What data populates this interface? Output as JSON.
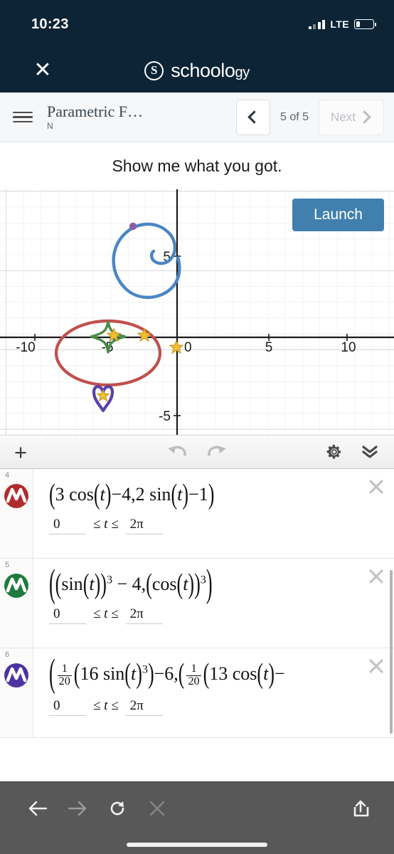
{
  "status_bar": {
    "time": "10:23",
    "network_label": "LTE",
    "signal_icon": "signal-bars-icon",
    "battery_icon": "battery-low-icon",
    "battery_level_pct": 22
  },
  "app_header": {
    "close_icon": "close-icon",
    "brand_mark": "S",
    "brand_name": "schoolo",
    "brand_name_tail": "gy"
  },
  "nav_bar": {
    "menu_icon": "hamburger-menu-icon",
    "title": "Parametric F…",
    "subtitle": "N",
    "prev_icon": "chevron-left-icon",
    "counter": "5 of 5",
    "next_label": "Next",
    "next_icon": "chevron-right-icon"
  },
  "prompt": {
    "text": "Show me what you got."
  },
  "graph": {
    "launch_label": "Launch",
    "accent_blue": "#4180ae",
    "x_ticks": [
      "-10",
      "-5",
      "0",
      "5",
      "10"
    ],
    "y_ticks": [
      "5",
      "-5"
    ],
    "x_range": [
      -12.5,
      12.7
    ],
    "y_range": [
      -6.6,
      8.8
    ],
    "curves": [
      {
        "name": "spiral",
        "color": "#4a86c5"
      },
      {
        "name": "ellipse",
        "color": "#c0504d"
      },
      {
        "name": "astroid",
        "color": "#4a8a4a"
      },
      {
        "name": "heart",
        "color": "#5b3fa8"
      }
    ],
    "point_color": "#8b5fa6",
    "star_color": "#f2c032"
  },
  "action_bar": {
    "add_icon": "plus-icon",
    "undo_icon": "undo-icon",
    "redo_icon": "redo-icon",
    "settings_icon": "gear-icon",
    "collapse_icon": "double-chevron-down-icon"
  },
  "expressions": [
    {
      "index": "4",
      "color": "#b02b2c",
      "icon": "parametric-curve-icon",
      "delete_icon": "close-icon",
      "formula_html": "<span class=\"paren\">(</span>3 <span class=\"fn\">cos</span><span class=\"paren\">(</span><span class=\"var\">t</span><span class=\"paren\">)</span>&#8722;4,2 <span class=\"fn\">sin</span><span class=\"paren\">(</span><span class=\"var\">t</span><span class=\"paren\">)</span>&#8722;1<span class=\"paren\">)</span>",
      "formula_text": "(3 cos(t)-4, 2 sin(t)-1)",
      "domain_min": "0",
      "domain_mid": "≤ t ≤",
      "domain_max": "2π"
    },
    {
      "index": "5",
      "color": "#1f7a3d",
      "icon": "parametric-curve-icon",
      "delete_icon": "close-icon",
      "formula_html": "<span class=\"bigparen\">(</span><span class=\"paren\">(</span><span class=\"fn\">sin</span><span class=\"paren\">(</span><span class=\"var\">t</span><span class=\"paren\">)</span><span class=\"paren\">)</span><sup class=\"exp\">3</sup> &#8722; 4,<span class=\"paren\">(</span><span class=\"fn\">cos</span><span class=\"paren\">(</span><span class=\"var\">t</span><span class=\"paren\">)</span><span class=\"paren\">)</span><sup class=\"exp\">3</sup><span class=\"bigparen\">)</span>",
      "formula_text": "((sin(t))^3 - 4, (cos(t))^3)",
      "domain_min": "0",
      "domain_mid": "≤ t ≤",
      "domain_max": "2π"
    },
    {
      "index": "6",
      "color": "#4b33a0",
      "icon": "parametric-curve-icon",
      "delete_icon": "close-icon",
      "formula_html": "<span class=\"bigparen\">(</span><span class=\"frac\"><span class=\"num\">1</span><span class=\"den\">20</span></span><span class=\"paren\">(</span>16 <span class=\"fn\">sin</span><span class=\"paren\">(</span><span class=\"var\">t</span><span class=\"paren\">)</span><sup class=\"exp\">3</sup><span class=\"paren\">)</span>&#8722;6,<span class=\"paren\">(</span><span class=\"frac\"><span class=\"num\">1</span><span class=\"den\">20</span></span><span class=\"paren\">(</span>13 <span class=\"fn\">cos</span><span class=\"paren\">(</span><span class=\"var\">t</span><span class=\"paren\">)</span>&#8722;",
      "formula_text": "(1/20(16 sin(t)^3)-6, (1/20(13 cos(t)-",
      "domain_min": "0",
      "domain_mid": "≤ t ≤",
      "domain_max": "2π"
    }
  ],
  "browser_bar": {
    "back_icon": "arrow-left-icon",
    "forward_icon": "arrow-right-icon",
    "reload_icon": "reload-icon",
    "stop_icon": "close-icon",
    "share_icon": "share-icon",
    "home_indicator": "home-indicator"
  }
}
